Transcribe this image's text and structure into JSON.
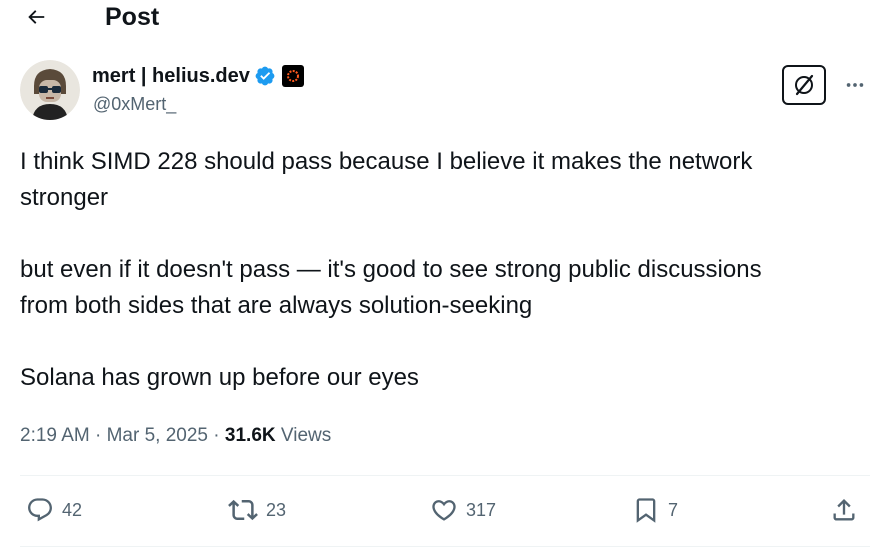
{
  "header": {
    "title": "Post"
  },
  "author": {
    "display_name": "mert | helius.dev",
    "handle": "@0xMert_",
    "verified": true
  },
  "post": {
    "text": "I think SIMD 228 should pass because I believe it makes the network\nstronger\n\nbut even if it doesn't pass — it's good to see strong public discussions\nfrom both sides that are always solution-seeking\n\nSolana has grown up before our eyes",
    "time": "2:19 AM",
    "separator": "·",
    "date": "Mar 5, 2025",
    "views_count": "31.6K",
    "views_label": "Views"
  },
  "actions": {
    "replies": "42",
    "reposts": "23",
    "likes": "317",
    "bookmarks": "7"
  },
  "icons": {
    "back": "arrow-left-icon",
    "verified": "verified-badge-icon",
    "affiliate": "affiliate-badge-icon",
    "grok": "grok-icon",
    "more": "more-horizontal-icon",
    "reply": "reply-icon",
    "repost": "repost-icon",
    "like": "heart-icon",
    "bookmark": "bookmark-icon",
    "share": "share-icon"
  },
  "colors": {
    "text": "#0f1419",
    "secondary": "#536471",
    "verified_blue": "#1d9bf0",
    "divider": "#eff3f4"
  }
}
